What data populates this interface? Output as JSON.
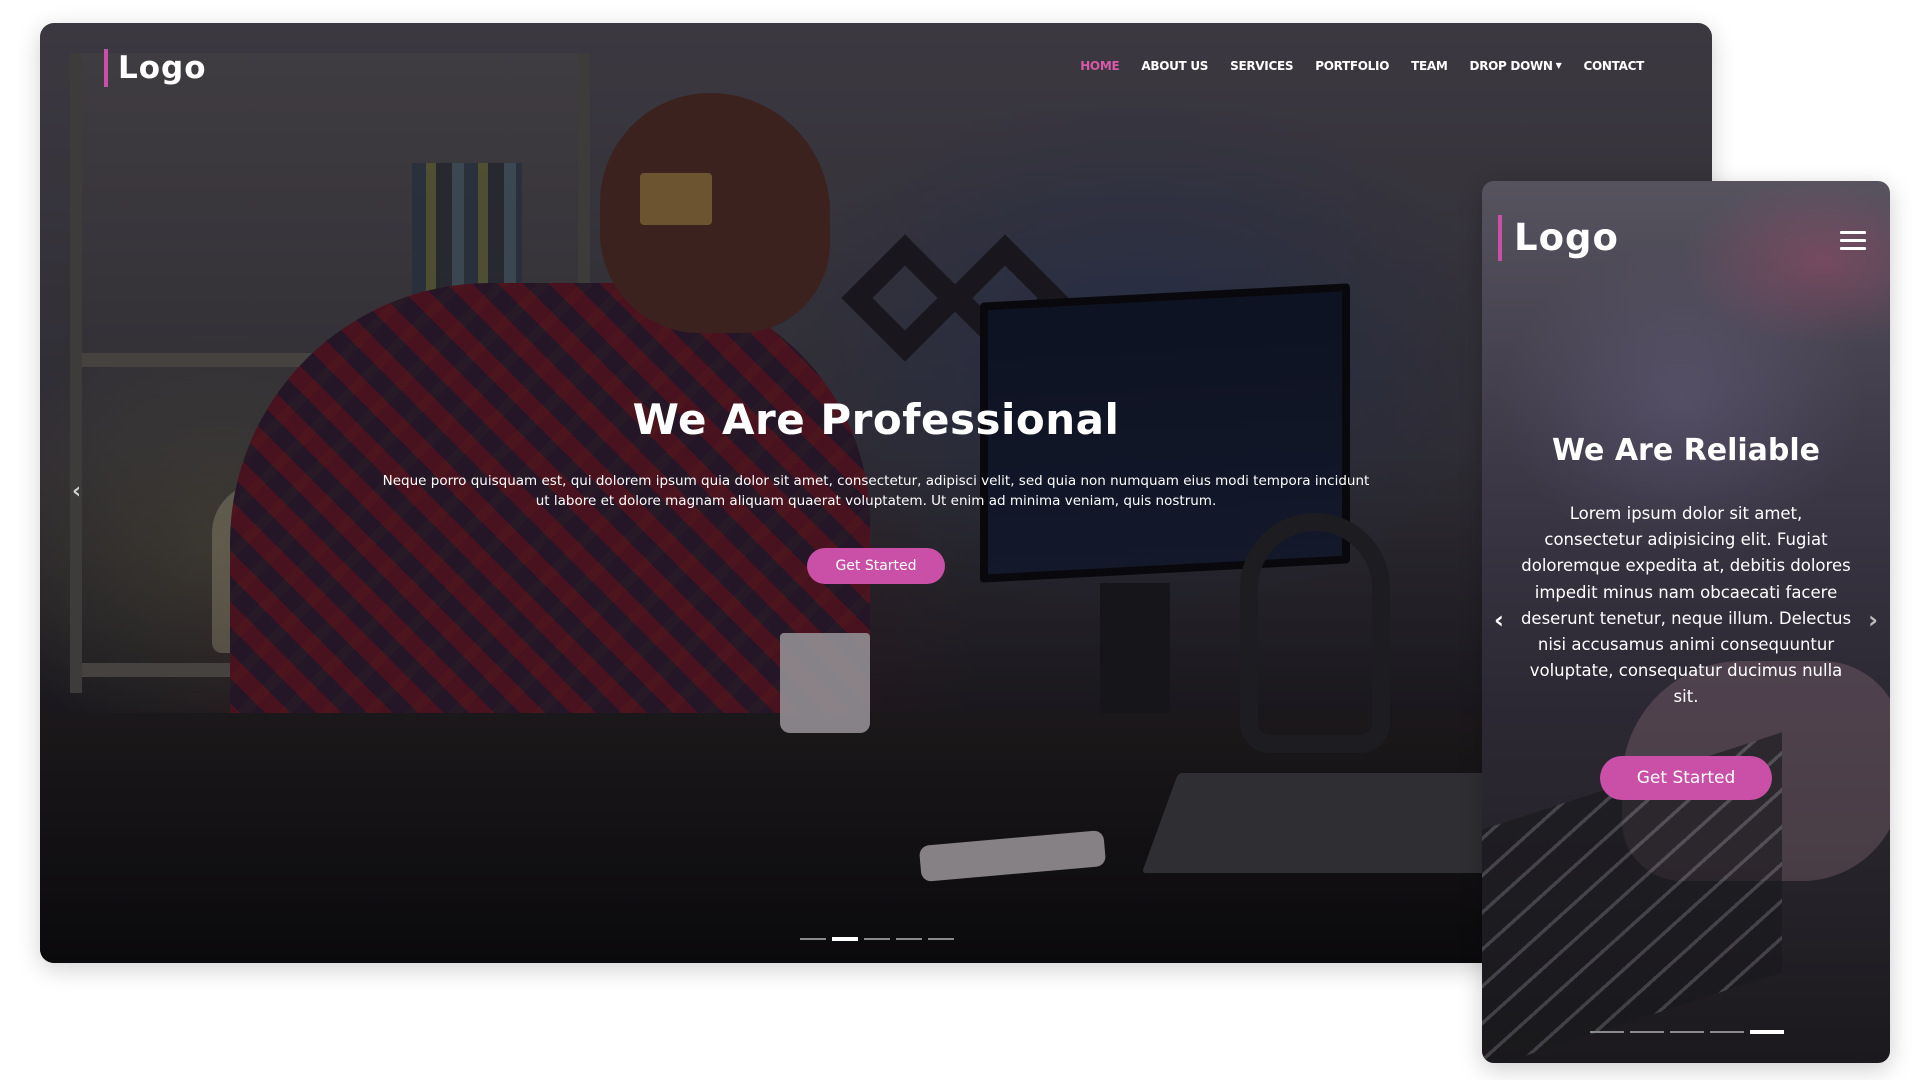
{
  "desktop": {
    "logo": "Logo",
    "nav": [
      {
        "label": "HOME",
        "active": true
      },
      {
        "label": "ABOUT US"
      },
      {
        "label": "SERVICES"
      },
      {
        "label": "PORTFOLIO"
      },
      {
        "label": "TEAM"
      },
      {
        "label": "DROP DOWN",
        "has_caret": true
      },
      {
        "label": "CONTACT"
      }
    ],
    "hero": {
      "title": "We Are Professional",
      "text": "Neque porro quisquam est, qui dolorem ipsum quia dolor sit amet, consectetur, adipisci velit, sed quia non numquam eius modi tempora incidunt ut labore et dolore magnam aliquam quaerat voluptatem. Ut enim ad minima veniam, quis nostrum.",
      "button": "Get Started",
      "prev_icon": "chevron-left-icon",
      "slide_count": 5,
      "active_slide": 2
    }
  },
  "mobile": {
    "logo": "Logo",
    "menu_icon": "hamburger-menu-icon",
    "hero": {
      "title": "We Are Reliable",
      "text": "Lorem ipsum dolor sit amet, consectetur adipisicing elit. Fugiat doloremque expedita at, debitis dolores impedit minus nam obcaecati facere deserunt tenetur, neque illum. Delectus nisi accusamus animi consequuntur voluptate, consequatur ducimus nulla sit.",
      "button": "Get Started",
      "prev_icon": "chevron-left-icon",
      "next_icon": "chevron-right-icon",
      "slide_count": 5,
      "active_slide": 5
    }
  },
  "colors": {
    "accent": "#c94fa7",
    "active_nav": "#d65aa9",
    "text": "#ffffff"
  }
}
